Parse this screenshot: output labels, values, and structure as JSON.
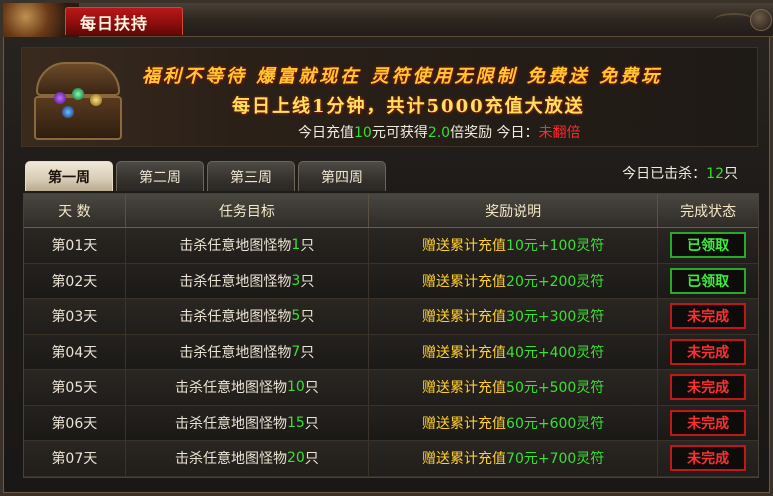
{
  "header": {
    "title": "每日扶持"
  },
  "banner": {
    "line1": "福利不等待 爆富就现在 灵符使用无限制 免费送 免费玩",
    "line2": "每日上线1分钟，共计5000充值大放送",
    "line3_prefix": "今日充值",
    "line3_amount": "10",
    "line3_mid": "元可获得",
    "line3_multiplier": "2.0",
    "line3_suffix": "倍奖励  今日：",
    "line3_status": "未翻倍"
  },
  "tabs": [
    "第一周",
    "第二周",
    "第三周",
    "第四周"
  ],
  "kill_count": {
    "label": "今日已击杀：",
    "value": "12",
    "unit": "只"
  },
  "table": {
    "headers": [
      "天 数",
      "任务目标",
      "奖励说明",
      "完成状态"
    ],
    "rows": [
      {
        "day": "第01天",
        "task": "击杀任意地图怪物",
        "count": "1",
        "unit": "只",
        "reward_prefix": "赠送累计充值",
        "reward_value": "10元+100灵符",
        "status": "已领取"
      },
      {
        "day": "第02天",
        "task": "击杀任意地图怪物",
        "count": "3",
        "unit": "只",
        "reward_prefix": "赠送累计充值",
        "reward_value": "20元+200灵符",
        "status": "已领取"
      },
      {
        "day": "第03天",
        "task": "击杀任意地图怪物",
        "count": "5",
        "unit": "只",
        "reward_prefix": "赠送累计充值",
        "reward_value": "30元+300灵符",
        "status": "未完成"
      },
      {
        "day": "第04天",
        "task": "击杀任意地图怪物",
        "count": "7",
        "unit": "只",
        "reward_prefix": "赠送累计充值",
        "reward_value": "40元+400灵符",
        "status": "未完成"
      },
      {
        "day": "第05天",
        "task": "击杀任意地图怪物",
        "count": "10",
        "unit": "只",
        "reward_prefix": "赠送累计充值",
        "reward_value": "50元+500灵符",
        "status": "未完成"
      },
      {
        "day": "第06天",
        "task": "击杀任意地图怪物",
        "count": "15",
        "unit": "只",
        "reward_prefix": "赠送累计充值",
        "reward_value": "60元+600灵符",
        "status": "未完成"
      },
      {
        "day": "第07天",
        "task": "击杀任意地图怪物",
        "count": "20",
        "unit": "只",
        "reward_prefix": "赠送累计充值",
        "reward_value": "70元+700灵符",
        "status": "未完成"
      }
    ]
  },
  "colors": {
    "accent_red": "#b81818",
    "green": "#3ae032",
    "gold": "#ffd030",
    "status_done": "#3af03a",
    "status_todo": "#ff3030"
  },
  "icons": {
    "close": "close-icon",
    "chest": "treasure-chest-icon"
  }
}
